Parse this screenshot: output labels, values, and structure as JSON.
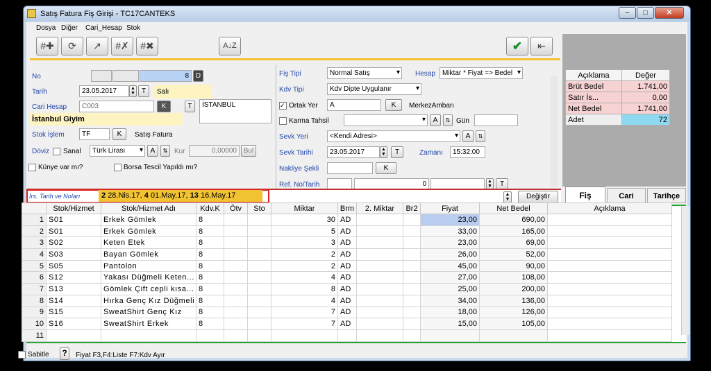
{
  "window": {
    "title": "Satış Fatura Fiş Girişi - TC17CANTEKS"
  },
  "menu": [
    "Dosya",
    "Diğer",
    "Cari_Hesap",
    "Stok"
  ],
  "summary": {
    "headers": [
      "Açıklama",
      "Değer"
    ],
    "rows": [
      {
        "label": "Brüt Bedel",
        "value": "1.741,00"
      },
      {
        "label": "Satır İs...",
        "value": "0,00"
      },
      {
        "label": "Net Bedel",
        "value": "1.741,00"
      },
      {
        "label": "Adet",
        "value": "72"
      }
    ]
  },
  "form": {
    "no_label": "No",
    "no_value": "8",
    "no_btn": "D",
    "tarih_label": "Tarih",
    "tarih_value": "23.05.2017",
    "tarih_btn": "T",
    "tarih_day": "Salı",
    "cari_label": "Cari Hesap",
    "cari_value": "C003",
    "cari_btn": "K",
    "cari_btn2": "T",
    "cari_city": "İSTANBUL",
    "cari_name": "İstanbul Giyim",
    "stok_islem_label": "Stok İşlem",
    "stok_islem_value": "TF",
    "stok_islem_btn": "K",
    "stok_islem_desc": "Satış Fatura",
    "doviz_label": "Döviz",
    "sanal_label": "Sanal",
    "doviz_value": "Türk Lirası",
    "doviz_btn": "A",
    "kur_label": "Kur",
    "kur_value": "0,00000",
    "kur_btn": "Bul",
    "kunye_label": "Künye var mı?",
    "borsa_label": "Borsa Tescil Yapıldı mı?",
    "fis_tipi_label": "Fiş Tipi",
    "fis_tipi_value": "Normal Satış",
    "hesap_label": "Hesap",
    "hesap_value": "Miktar * Fiyat => Bedel",
    "kdv_tipi_label": "Kdv Tipi",
    "kdv_tipi_value": "Kdv Dipte Uygulanır",
    "ortak_yer_label": "Ortak Yer",
    "ortak_yer_value": "A",
    "ortak_yer_btn": "K",
    "ortak_yer_desc": "MerkezAmbarı",
    "karma_label": "Karma Tahsil",
    "karma_btn": "A",
    "gun_label": "Gün",
    "sevk_yeri_label": "Sevk Yeri",
    "sevk_yeri_value": "<Kendi Adresi>",
    "sevk_yeri_btn": "A",
    "sevk_tarihi_label": "Sevk Tarihi",
    "sevk_tarihi_value": "23.05.2017",
    "sevk_tarihi_btn": "T",
    "zamani_label": "Zamanı",
    "zamani_value": "15:32:00",
    "nakliye_label": "Nakliye Şekli",
    "nakliye_btn": "K",
    "ref_label": "Ref. No/Tarih",
    "ref_value": "0",
    "ref_btn": "T"
  },
  "irs": {
    "label": "İrs. Tarih ve Noları",
    "entries": [
      {
        "no": "2",
        "date": "28.Nis.17"
      },
      {
        "no": "4",
        "date": "01.May.17"
      },
      {
        "no": "13",
        "date": "16.May.17"
      }
    ],
    "degistir": "Değiştir"
  },
  "tabs": [
    "Fiş",
    "Cari",
    "Tarihçe"
  ],
  "grid": {
    "columns": [
      "",
      "Stok/Hizmet",
      "Stok/Hizmet Adı",
      "Kdv.K",
      "Ötv",
      "Sto",
      "Miktar",
      "Brm",
      "2. Miktar",
      "Br2",
      "Fiyat",
      "Net Bedel",
      "Açıklama"
    ],
    "rows": [
      [
        "1",
        "S01",
        "Erkek Gömlek",
        "8",
        "",
        "",
        "30",
        "AD",
        "",
        "",
        "23,00",
        "690,00",
        ""
      ],
      [
        "2",
        "S01",
        "Erkek Gömlek",
        "8",
        "",
        "",
        "5",
        "AD",
        "",
        "",
        "33,00",
        "165,00",
        ""
      ],
      [
        "3",
        "S02",
        "Keten Etek",
        "8",
        "",
        "",
        "3",
        "AD",
        "",
        "",
        "23,00",
        "69,00",
        ""
      ],
      [
        "4",
        "S03",
        "Bayan Gömlek",
        "8",
        "",
        "",
        "2",
        "AD",
        "",
        "",
        "26,00",
        "52,00",
        ""
      ],
      [
        "5",
        "S05",
        "Pantolon",
        "8",
        "",
        "",
        "2",
        "AD",
        "",
        "",
        "45,00",
        "90,00",
        ""
      ],
      [
        "6",
        "S12",
        "Yakası Düğmeli Keten...",
        "8",
        "",
        "",
        "4",
        "AD",
        "",
        "",
        "27,00",
        "108,00",
        ""
      ],
      [
        "7",
        "S13",
        "Gömlek Çift cepli kısa...",
        "8",
        "",
        "",
        "8",
        "AD",
        "",
        "",
        "25,00",
        "200,00",
        ""
      ],
      [
        "8",
        "S14",
        "Hırka Genç Kız Düğmeli",
        "8",
        "",
        "",
        "4",
        "AD",
        "",
        "",
        "34,00",
        "136,00",
        ""
      ],
      [
        "9",
        "S15",
        "SweatShirt Genç Kız",
        "8",
        "",
        "",
        "7",
        "AD",
        "",
        "",
        "18,00",
        "126,00",
        ""
      ],
      [
        "10",
        "S16",
        "SweatShirt Erkek",
        "8",
        "",
        "",
        "7",
        "AD",
        "",
        "",
        "15,00",
        "105,00",
        ""
      ],
      [
        "11",
        "",
        "",
        "",
        "",
        "",
        "",
        "",
        "",
        "",
        "",
        "",
        ""
      ]
    ]
  },
  "status": {
    "sabitle": "Sabitle",
    "help": "?",
    "hint": "Fiyat F3,F4:Liste  F7:Kdv Ayır"
  },
  "colors": {
    "selected_cell": "#b9cdf0",
    "gold": "#f1c232",
    "red_highlight": "#e02020",
    "brut_bg": "#f6d2d2",
    "adet_bg": "#8fd9f0"
  }
}
